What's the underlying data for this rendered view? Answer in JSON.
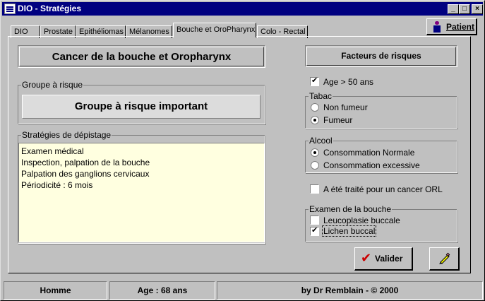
{
  "window": {
    "title": "DIO - Stratégies"
  },
  "tabs": [
    {
      "label": "DIO"
    },
    {
      "label": "Prostate"
    },
    {
      "label": "Epithéliomas"
    },
    {
      "label": "Mélanomes"
    },
    {
      "label": "Bouche et OroPharynx"
    },
    {
      "label": "Colo - Rectal"
    }
  ],
  "patient_button": {
    "label": "Patient"
  },
  "main": {
    "title": "Cancer de la bouche et Oropharynx",
    "risk_group": {
      "label": "Groupe à risque",
      "value": "Groupe à risque important"
    },
    "strategies": {
      "label": "Stratégies de dépistage",
      "lines": [
        "Examen médical",
        "Inspection, palpation de la bouche",
        "Palpation des ganglions cervicaux",
        "Périodicité : 6 mois"
      ]
    }
  },
  "risk_factors": {
    "title": "Facteurs de risques",
    "age": {
      "label": "Age > 50 ans",
      "checked": true
    },
    "tabac": {
      "label": "Tabac",
      "options": [
        "Non fumeur",
        "Fumeur"
      ],
      "selected": "Fumeur"
    },
    "alcool": {
      "label": "Alcool",
      "options": [
        "Consommation Normale",
        "Consommation excessive"
      ],
      "selected": "Consommation Normale"
    },
    "orl": {
      "label": "A été traité pour un cancer ORL",
      "checked": false
    },
    "examen": {
      "label": "Examen de la bouche",
      "items": [
        {
          "label": "Leucoplasie buccale",
          "checked": false
        },
        {
          "label": "Lichen buccal",
          "checked": true
        }
      ]
    }
  },
  "buttons": {
    "valider": "Valider"
  },
  "statusbar": {
    "sex": "Homme",
    "age": "Age : 68 ans",
    "credit": "by Dr Remblain - © 2000"
  }
}
